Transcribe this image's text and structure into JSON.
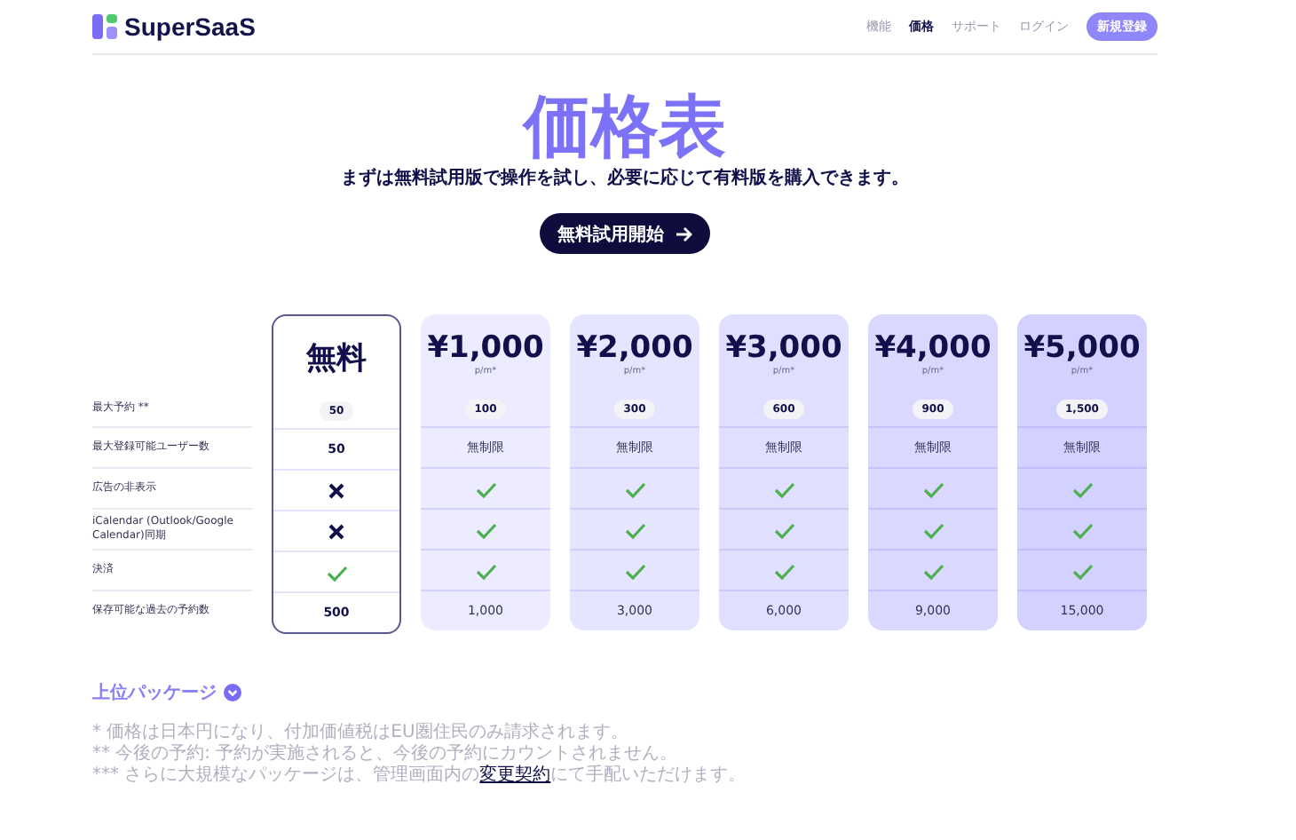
{
  "nav": {
    "logo": "SuperSaaS",
    "links": [
      {
        "label": "機能",
        "selected": false
      },
      {
        "label": "価格",
        "selected": true
      },
      {
        "label": "サポート",
        "selected": false
      },
      {
        "label": "ログイン",
        "selected": false
      }
    ],
    "signup": "新規登録"
  },
  "hero": {
    "title": "価格表",
    "subtitle": "まずは無料試用版で操作を試し、必要に応じて有料版を購入できます。",
    "cta": "無料試用開始"
  },
  "features": [
    "最大予約 **",
    "最大登録可能ユーザー数",
    "広告の非表示",
    "iCalendar (Outlook/Google Calendar)同期",
    "決済",
    "保存可能な過去の予約数"
  ],
  "plans": [
    {
      "price": "無料",
      "featured": true,
      "color": "#ffffff",
      "cells": [
        {
          "kind": "pill",
          "text": "50"
        },
        {
          "kind": "text",
          "text": "50"
        },
        {
          "kind": "mark",
          "included": false
        },
        {
          "kind": "mark",
          "included": false
        },
        {
          "kind": "mark",
          "included": true
        },
        {
          "kind": "text",
          "text": "500"
        }
      ]
    },
    {
      "price": "¥1,000",
      "unit": "p/m*",
      "featured": false,
      "color": "#ecebff",
      "cells": [
        {
          "kind": "pill",
          "text": "100"
        },
        {
          "kind": "text",
          "text": "無制限"
        },
        {
          "kind": "mark",
          "included": true
        },
        {
          "kind": "mark",
          "included": true
        },
        {
          "kind": "mark",
          "included": true
        },
        {
          "kind": "text",
          "text": "1,000"
        }
      ]
    },
    {
      "price": "¥2,000",
      "unit": "p/m*",
      "featured": false,
      "color": "#e6e5ff",
      "cells": [
        {
          "kind": "pill",
          "text": "300"
        },
        {
          "kind": "text",
          "text": "無制限"
        },
        {
          "kind": "mark",
          "included": true
        },
        {
          "kind": "mark",
          "included": true
        },
        {
          "kind": "mark",
          "included": true
        },
        {
          "kind": "text",
          "text": "3,000"
        }
      ]
    },
    {
      "price": "¥3,000",
      "unit": "p/m*",
      "featured": false,
      "color": "#e0dfff",
      "cells": [
        {
          "kind": "pill",
          "text": "600"
        },
        {
          "kind": "text",
          "text": "無制限"
        },
        {
          "kind": "mark",
          "included": true
        },
        {
          "kind": "mark",
          "included": true
        },
        {
          "kind": "mark",
          "included": true
        },
        {
          "kind": "text",
          "text": "6,000"
        }
      ]
    },
    {
      "price": "¥4,000",
      "unit": "p/m*",
      "featured": false,
      "color": "#dad8ff",
      "cells": [
        {
          "kind": "pill",
          "text": "900"
        },
        {
          "kind": "text",
          "text": "無制限"
        },
        {
          "kind": "mark",
          "included": true
        },
        {
          "kind": "mark",
          "included": true
        },
        {
          "kind": "mark",
          "included": true
        },
        {
          "kind": "text",
          "text": "9,000"
        }
      ]
    },
    {
      "price": "¥5,000",
      "unit": "p/m*",
      "featured": false,
      "color": "#d3d1ff",
      "cells": [
        {
          "kind": "pill",
          "text": "1,500"
        },
        {
          "kind": "text",
          "text": "無制限"
        },
        {
          "kind": "mark",
          "included": true
        },
        {
          "kind": "mark",
          "included": true
        },
        {
          "kind": "mark",
          "included": true
        },
        {
          "kind": "text",
          "text": "15,000"
        }
      ]
    }
  ],
  "more_packages": "上位パッケージ",
  "footnotes": [
    {
      "text": "* 価格は日本円になり、付加価値税はEU圏住民のみ請求されます。"
    },
    {
      "text": "** 今後の予約: 予約が実施されると、今後の予約にカウントされません。"
    },
    {
      "text": "*** さらに大規模なパッケージは、管理画面内の",
      "link": "変更契約",
      "after": "にて手配いただけます。"
    }
  ]
}
